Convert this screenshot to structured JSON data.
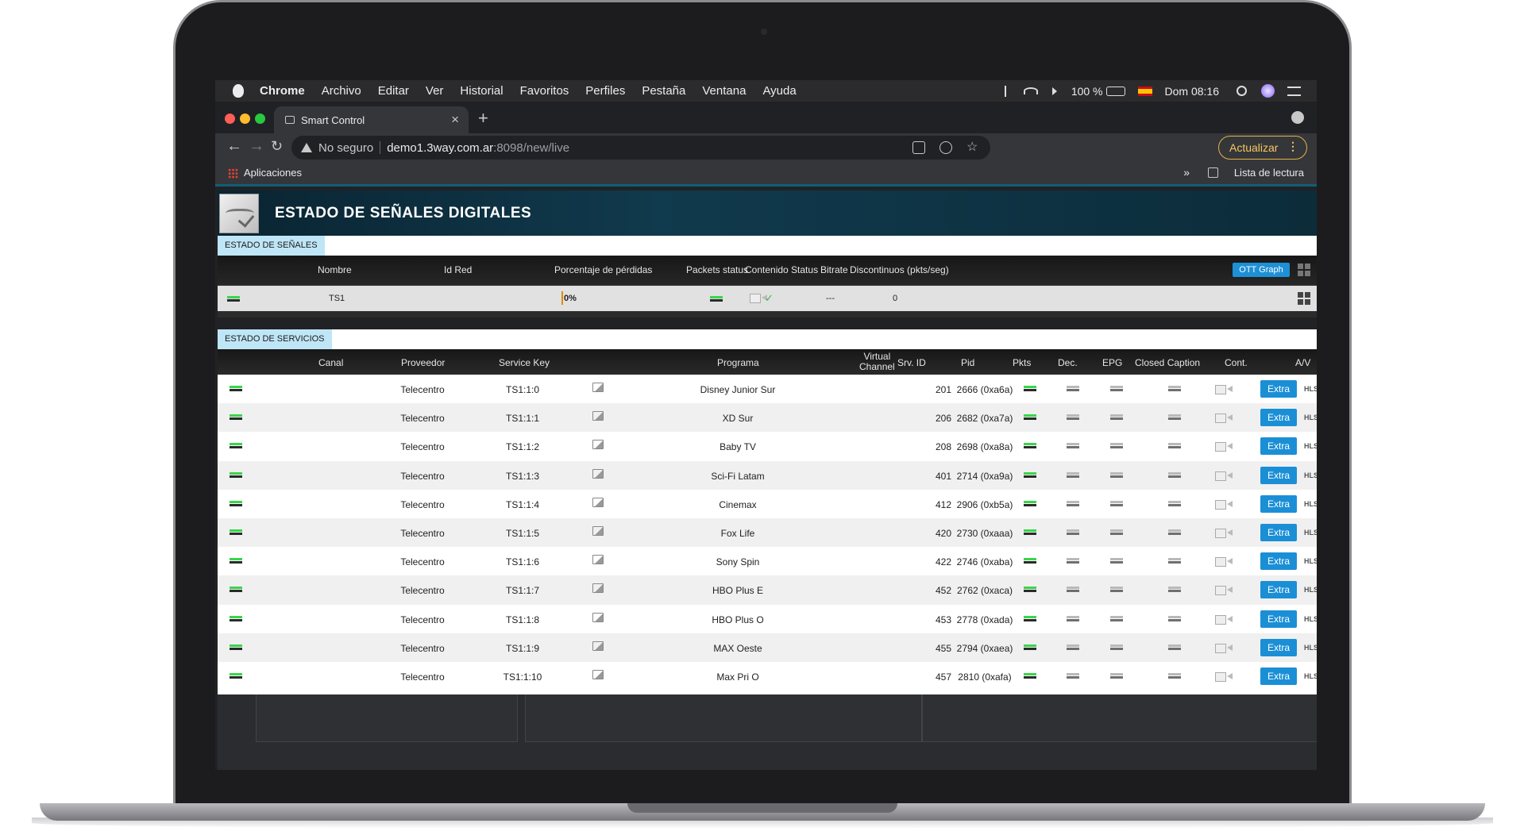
{
  "menubar": {
    "app": "Chrome",
    "items": [
      "Archivo",
      "Editar",
      "Ver",
      "Historial",
      "Favoritos",
      "Perfiles",
      "Pestaña",
      "Ventana",
      "Ayuda"
    ],
    "battery": "100 %",
    "clock": "Dom 08:16"
  },
  "browser": {
    "tab_title": "Smart Control",
    "security_label": "No seguro",
    "url_host": "demo1.3way.com.ar",
    "url_path": ":8098/new/live",
    "update_label": "Actualizar",
    "bookmark_apps": "Aplicaciones",
    "bookmark_chevron": "»",
    "reading_list": "Lista de lectura"
  },
  "app": {
    "title": "ESTADO DE SEÑALES DIGITALES"
  },
  "signals": {
    "section_label": "ESTADO DE SEÑALES",
    "headers": {
      "name": "Nombre",
      "net_id": "Id Red",
      "loss": "Porcentaje de pérdidas",
      "packets": "Packets status",
      "content": "Contenido Status",
      "bitrate": "Bitrate",
      "discont": "Discontinuos (pkts/seg)"
    },
    "ott_graph_label": "OTT Graph",
    "row": {
      "name": "TS1",
      "loss": "0%",
      "bitrate": "---",
      "discont": "0",
      "status_color": "#38d64a",
      "content_icon": "check-icon"
    }
  },
  "services": {
    "section_label": "ESTADO DE SERVICIOS",
    "headers": {
      "canal": "Canal",
      "proveedor": "Proveedor",
      "service_key": "Service Key",
      "programa": "Programa",
      "virtual_channel_1": "Virtual",
      "virtual_channel_2": "Channel",
      "srv_id": "Srv. ID",
      "pid": "Pid",
      "pkts": "Pkts",
      "dec": "Dec.",
      "epg": "EPG",
      "cc": "Closed Caption",
      "cont": "Cont.",
      "av": "A/V"
    },
    "extra_label": "Extra",
    "hls_label": "HLS",
    "rows": [
      {
        "proveedor": "Telecentro",
        "key": "TS1:1:0",
        "programa": "Disney Junior Sur",
        "srv_id": "201",
        "pid": "2666 (0xa6a)"
      },
      {
        "proveedor": "Telecentro",
        "key": "TS1:1:1",
        "programa": "XD Sur",
        "srv_id": "206",
        "pid": "2682 (0xa7a)"
      },
      {
        "proveedor": "Telecentro",
        "key": "TS1:1:2",
        "programa": "Baby TV",
        "srv_id": "208",
        "pid": "2698 (0xa8a)"
      },
      {
        "proveedor": "Telecentro",
        "key": "TS1:1:3",
        "programa": "Sci-Fi Latam",
        "srv_id": "401",
        "pid": "2714 (0xa9a)"
      },
      {
        "proveedor": "Telecentro",
        "key": "TS1:1:4",
        "programa": "Cinemax",
        "srv_id": "412",
        "pid": "2906 (0xb5a)"
      },
      {
        "proveedor": "Telecentro",
        "key": "TS1:1:5",
        "programa": "Fox Life",
        "srv_id": "420",
        "pid": "2730 (0xaaa)"
      },
      {
        "proveedor": "Telecentro",
        "key": "TS1:1:6",
        "programa": "Sony Spin",
        "srv_id": "422",
        "pid": "2746 (0xaba)"
      },
      {
        "proveedor": "Telecentro",
        "key": "TS1:1:7",
        "programa": "HBO Plus E",
        "srv_id": "452",
        "pid": "2762 (0xaca)"
      },
      {
        "proveedor": "Telecentro",
        "key": "TS1:1:8",
        "programa": "HBO Plus O",
        "srv_id": "453",
        "pid": "2778 (0xada)"
      },
      {
        "proveedor": "Telecentro",
        "key": "TS1:1:9",
        "programa": "MAX Oeste",
        "srv_id": "455",
        "pid": "2794 (0xaea)"
      },
      {
        "proveedor": "Telecentro",
        "key": "TS1:1:10",
        "programa": "Max Pri O",
        "srv_id": "457",
        "pid": "2810 (0xafa)"
      }
    ]
  }
}
